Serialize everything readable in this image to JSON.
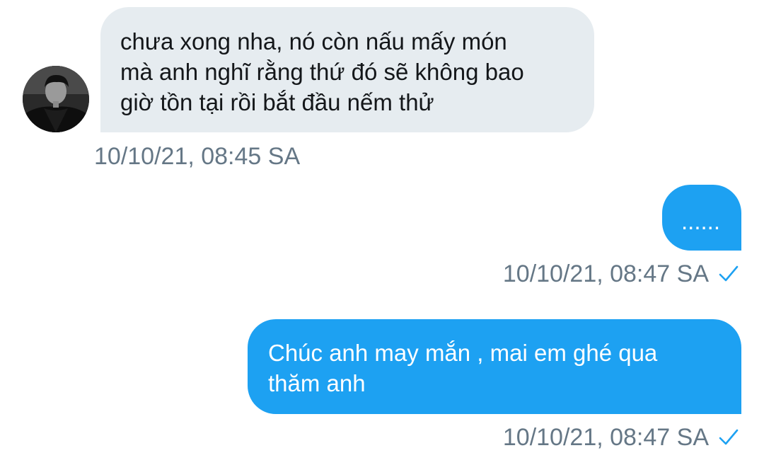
{
  "conversation": {
    "messages": [
      {
        "direction": "incoming",
        "text": "chưa xong nha, nó còn nấu mấy món\nmà anh nghĩ rằng thứ đó sẽ không bao\ngiờ tồn tại rồi bắt đầu nếm thử",
        "timestamp": "10/10/21, 08:45 SA",
        "has_avatar": true
      },
      {
        "direction": "outgoing",
        "text": "......",
        "timestamp": "10/10/21, 08:47 SA",
        "status_icon": "check-icon"
      },
      {
        "direction": "outgoing",
        "text": "Chúc anh may mắn , mai em ghé qua\nthăm anh",
        "timestamp": "10/10/21, 08:47 SA",
        "status_icon": "check-icon"
      }
    ]
  },
  "colors": {
    "incoming_bubble": "#e6ecf0",
    "outgoing_bubble": "#1da1f2",
    "timestamp_text": "#657786",
    "check": "#1da1f2"
  }
}
